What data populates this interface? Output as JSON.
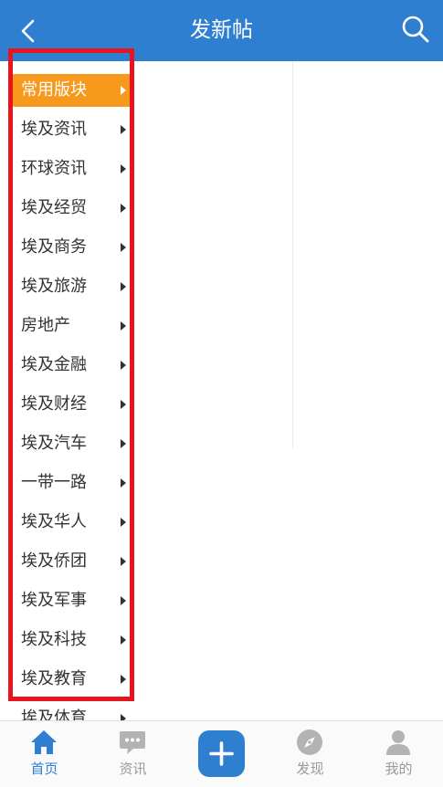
{
  "header": {
    "title": "发新帖"
  },
  "sidebar": {
    "items": [
      {
        "label": "常用版块",
        "active": true
      },
      {
        "label": "埃及资讯"
      },
      {
        "label": "环球资讯"
      },
      {
        "label": "埃及经贸"
      },
      {
        "label": "埃及商务"
      },
      {
        "label": "埃及旅游"
      },
      {
        "label": "房地产"
      },
      {
        "label": "埃及金融"
      },
      {
        "label": "埃及财经"
      },
      {
        "label": "埃及汽车"
      },
      {
        "label": "一带一路"
      },
      {
        "label": "埃及华人"
      },
      {
        "label": "埃及侨团"
      },
      {
        "label": "埃及军事"
      },
      {
        "label": "埃及科技"
      },
      {
        "label": "埃及教育"
      },
      {
        "label": "埃及体育"
      }
    ]
  },
  "tabbar": {
    "home": "首页",
    "news": "资讯",
    "discover": "发现",
    "mine": "我的"
  },
  "colors": {
    "brand": "#2f7fd1",
    "active_item": "#f7991c",
    "highlight": "#e8141d"
  },
  "icons": [
    "back-icon",
    "search-icon",
    "caret-right-icon",
    "home-icon",
    "chat-icon",
    "plus-icon",
    "compass-icon",
    "user-icon"
  ]
}
